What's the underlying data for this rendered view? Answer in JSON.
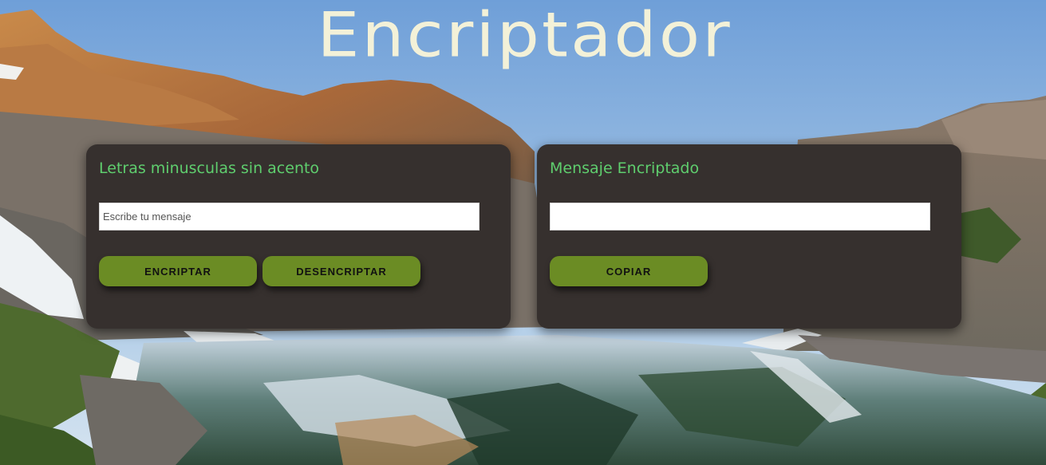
{
  "header": {
    "title": "Encriptador"
  },
  "encrypt_panel": {
    "heading": "Letras minusculas sin acento",
    "input_placeholder": "Escribe tu mensaje",
    "input_value": "",
    "encrypt_label": "ENCRIPTAR",
    "decrypt_label": "DESENCRIPTAR"
  },
  "result_panel": {
    "heading": "Mensaje Encriptado",
    "output_value": "",
    "copy_label": "COPIAR"
  },
  "colors": {
    "panel_bg": "#36302e",
    "heading_green": "#5fce6e",
    "button_green": "#6b8c24",
    "title_cream": "#f3f1d8"
  }
}
